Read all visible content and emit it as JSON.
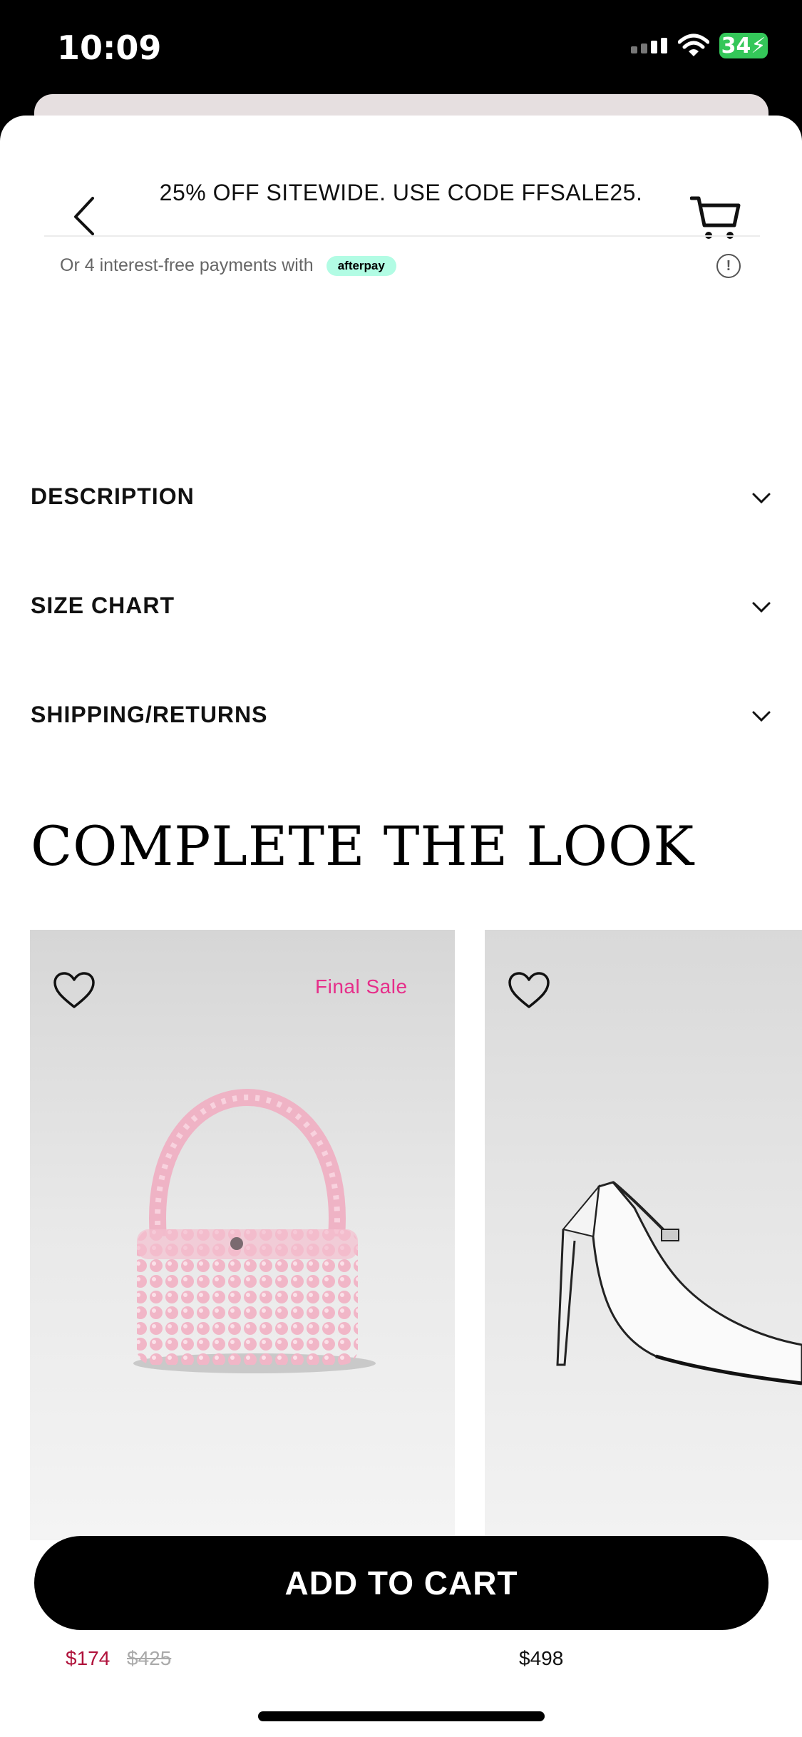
{
  "status_bar": {
    "time": "10:09",
    "battery": "34"
  },
  "header": {
    "promo": "25% OFF SITEWIDE. USE CODE FFSALE25."
  },
  "afterpay": {
    "text": "Or 4 interest-free payments with",
    "badge": "afterpay"
  },
  "accordions": [
    {
      "label": "DESCRIPTION"
    },
    {
      "label": "SIZE CHART"
    },
    {
      "label": "SHIPPING/RETURNS"
    }
  ],
  "complete_the_look": {
    "title": "COMPLETE THE LOOK",
    "products": [
      {
        "badge": "Final Sale",
        "price": "$174",
        "original_price": "$425",
        "image": "pink beaded handbag"
      },
      {
        "price": "$498",
        "image": "white slingback pump"
      }
    ]
  },
  "cta": {
    "add_to_cart": "ADD TO CART"
  },
  "colors": {
    "accent_sale": "#e62e8a",
    "price_sale": "#b0123b",
    "afterpay": "#b2fce4",
    "cta": "#000000"
  }
}
